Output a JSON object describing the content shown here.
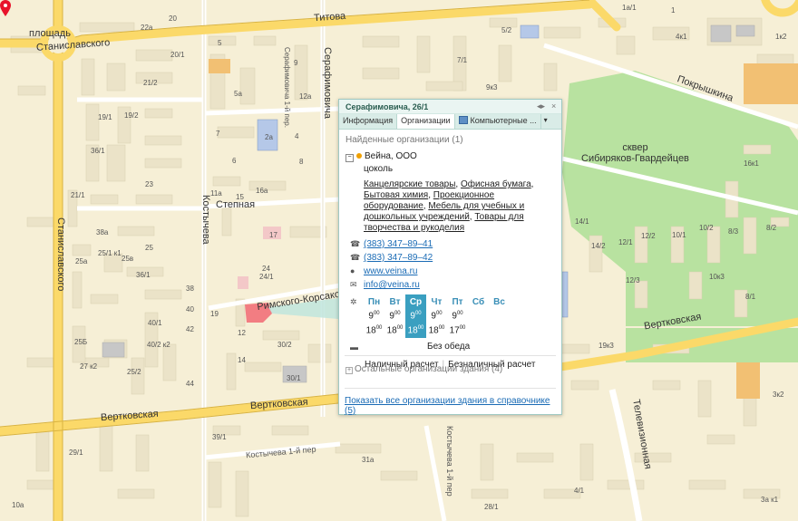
{
  "map": {
    "streets": [
      "Титова",
      "площадь",
      "Станиславского",
      "Станиславского",
      "Серафимовича",
      "Серафимовича 1-й пер.",
      "Покрышкина",
      "Степная",
      "Костычева",
      "Римского-Корсакова",
      "Вертковская",
      "Вертковская",
      "Вертковская",
      "Костычева 1-й пер",
      "Костычева 1-й пер",
      "Телевизионная"
    ],
    "park_label": "сквер\nСибиряков-Гвардейцев",
    "building_numbers": [
      "22а",
      "20",
      "20/1",
      "21/2",
      "21/1",
      "19/1",
      "19/2",
      "36/1",
      "25",
      "25а",
      "23",
      "38а",
      "25/1 к1",
      "25в",
      "36/1",
      "40/1",
      "40/2 к2",
      "25/2",
      "27 к2",
      "25Б",
      "29/1",
      "10а",
      "5",
      "5а",
      "9",
      "12а",
      "2а",
      "4",
      "6",
      "8",
      "7",
      "11а",
      "15",
      "16а",
      "17",
      "24",
      "24/1",
      "19",
      "12",
      "14",
      "30/2",
      "30/1",
      "38",
      "40",
      "42",
      "44",
      "39/1",
      "31а",
      "28/1",
      "1а/1",
      "1",
      "4к1",
      "1к2",
      "5/2",
      "7/1",
      "9к3",
      "16к1",
      "14/1",
      "14/2",
      "12/1",
      "12/2",
      "10/1",
      "10/2",
      "8/3",
      "8/2",
      "10к3",
      "12/3",
      "8/1",
      "19к3",
      "3к2",
      "3а к1",
      "4/1"
    ],
    "colors": {
      "background": "#f6efd6",
      "major_road": "#fbd969",
      "park": "#b8e2a0",
      "selected_building": "#f27d82",
      "building": "#ebe3c8"
    }
  },
  "popup": {
    "title": "Серафимовича, 26/1",
    "controls": [
      "◂▸",
      "×"
    ],
    "tabs": [
      "Информация",
      "Организации",
      "Компьютерные ..."
    ],
    "tab_more": "▾",
    "active_tab": "Организации",
    "found_label": "Найденные организации (1)",
    "org": {
      "name": "Вейна, ООО",
      "floor": "цоколь",
      "categories": [
        "Канцелярские товары",
        "Офисная бумага",
        "Бытовая химия",
        "Проекционное оборудование",
        "Мебель для учебных и дошкольных учреждений",
        "Товары для творчества и рукоделия"
      ],
      "phones": [
        "(383) 347–89–41",
        "(383) 347–89–42"
      ],
      "website": "www.veina.ru",
      "email": "info@veina.ru",
      "days": [
        "Пн",
        "Вт",
        "Ср",
        "Чт",
        "Пт",
        "Сб",
        "Вс"
      ],
      "today_index": 2,
      "open_hours": [
        "9",
        "9",
        "9",
        "9",
        "9",
        "",
        ""
      ],
      "open_minutes": [
        "00",
        "00",
        "00",
        "00",
        "00",
        "",
        ""
      ],
      "close_hours": [
        "18",
        "18",
        "18",
        "18",
        "17",
        "",
        ""
      ],
      "close_minutes": [
        "00",
        "00",
        "00",
        "00",
        "00",
        "",
        ""
      ],
      "lunch": "Без обеда",
      "payment": [
        "Наличный расчет",
        "Безналичный расчет"
      ]
    },
    "other_orgs": "Остальные организации здания (4)",
    "show_all_link": "Показать все организации здания в справочнике (5)"
  }
}
